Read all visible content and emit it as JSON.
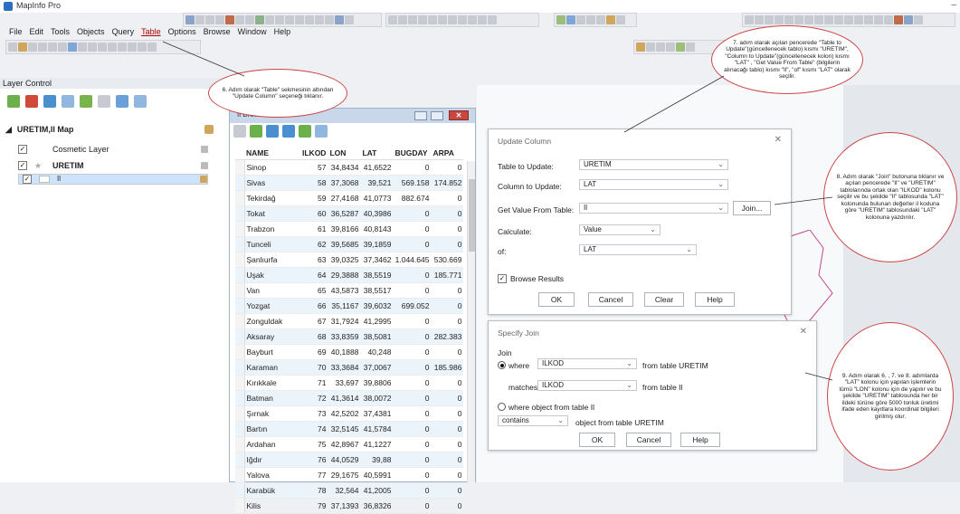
{
  "app": {
    "title": "MapInfo Pro"
  },
  "menu": [
    "File",
    "Edit",
    "Tools",
    "Objects",
    "Query",
    "Table",
    "Options",
    "Browse",
    "Window",
    "Help"
  ],
  "layer_control": {
    "title": "Layer Control",
    "map_name": "URETIM,Il Map",
    "layers": [
      {
        "name": "Cosmetic Layer",
        "checked": true
      },
      {
        "name": "URETIM",
        "checked": true
      },
      {
        "name": "Il",
        "checked": true
      }
    ]
  },
  "browser": {
    "title": "Il Browser",
    "columns": [
      "NAME",
      "ILKOD",
      "LON",
      "LAT",
      "BUGDAY",
      "ARPA"
    ],
    "rows": [
      [
        "Sinop",
        "57",
        "34,8434",
        "41,6522",
        "0",
        "0"
      ],
      [
        "Sivas",
        "58",
        "37,3068",
        "39,521",
        "569.158",
        "174.852"
      ],
      [
        "Tekirdağ",
        "59",
        "27,4168",
        "41,0773",
        "882.674",
        "0"
      ],
      [
        "Tokat",
        "60",
        "36,5287",
        "40,3986",
        "0",
        "0"
      ],
      [
        "Trabzon",
        "61",
        "39,8166",
        "40,8143",
        "0",
        "0"
      ],
      [
        "Tunceli",
        "62",
        "39,5685",
        "39,1859",
        "0",
        "0"
      ],
      [
        "Şanlıurfa",
        "63",
        "39,0325",
        "37,3462",
        "1.044.645",
        "530.669"
      ],
      [
        "Uşak",
        "64",
        "29,3888",
        "38,5519",
        "0",
        "185.771"
      ],
      [
        "Van",
        "65",
        "43,5873",
        "38,5517",
        "0",
        "0"
      ],
      [
        "Yozgat",
        "66",
        "35,1167",
        "39,6032",
        "699.052",
        "0"
      ],
      [
        "Zonguldak",
        "67",
        "31,7924",
        "41,2995",
        "0",
        "0"
      ],
      [
        "Aksaray",
        "68",
        "33,8359",
        "38,5081",
        "0",
        "282.383"
      ],
      [
        "Bayburt",
        "69",
        "40,1888",
        "40,248",
        "0",
        "0"
      ],
      [
        "Karaman",
        "70",
        "33,3684",
        "37,0067",
        "0",
        "185.986"
      ],
      [
        "Kırıkkale",
        "71",
        "33,697",
        "39,8806",
        "0",
        "0"
      ],
      [
        "Batman",
        "72",
        "41,3614",
        "38,0072",
        "0",
        "0"
      ],
      [
        "Şırnak",
        "73",
        "42,5202",
        "37,4381",
        "0",
        "0"
      ],
      [
        "Bartın",
        "74",
        "32,5145",
        "41,5784",
        "0",
        "0"
      ],
      [
        "Ardahan",
        "75",
        "42,8967",
        "41,1227",
        "0",
        "0"
      ],
      [
        "Iğdır",
        "76",
        "44,0529",
        "39,88",
        "0",
        "0"
      ],
      [
        "Yalova",
        "77",
        "29,1675",
        "40,5991",
        "0",
        "0"
      ],
      [
        "Karabük",
        "78",
        "32,564",
        "41,2005",
        "0",
        "0"
      ],
      [
        "Kilis",
        "79",
        "37,1393",
        "36,8326",
        "0",
        "0"
      ]
    ]
  },
  "update_column": {
    "title": "Update Column",
    "table_to_update_label": "Table to Update:",
    "table_to_update": "URETIM",
    "column_to_update_label": "Column to Update:",
    "column_to_update": "LAT",
    "get_value_label": "Get Value From Table:",
    "get_value": "Il",
    "join_button": "Join...",
    "calculate_label": "Calculate:",
    "calculate": "Value",
    "of_label": "of:",
    "of": "LAT",
    "browse_results": "Browse Results",
    "ok": "OK",
    "cancel": "Cancel",
    "clear": "Clear",
    "help": "Help"
  },
  "specify_join": {
    "title": "Specify Join",
    "join_label": "Join",
    "where_label": "where",
    "where_value": "ILKOD",
    "from_table_uretim": "from table URETIM",
    "matches_label": "matches",
    "matches_value": "ILKOD",
    "from_table_il": "from table Il",
    "where_object_label": "where object from table Il",
    "contains": "contains",
    "object_from": "object from table URETIM",
    "ok": "OK",
    "cancel": "Cancel",
    "help": "Help"
  },
  "callouts": {
    "step6": "6. Adım olarak \"Table\" sekmesinin altından \"Update Column\" seçeneği tıklanır.",
    "step7": "7. adım olarak açılan pencerede \"Table to Update\"(güncellenecek tablo) kısmı \"URETIM\", \"Column to Update\"(güncellenecek kolon) kısmı \"LAT\" , \"Get Value From Table\" (bilgilerin alınacağı tablo) kısmı \"Il\", \"of\" kısmı \"LAT\" olarak seçilir.",
    "step8": "8. Adım olarak \"Join\" butonuna tıklanır ve açılan pencerede \"Il\" ve \"URETIM\" tablolarında ortak olan \"ILKOD\" kolonu seçilir ve bu şekilde \"Il\" tablosunda \"LAT\" kolonunda bulunan değerler il koduna göre \"URETIM\" tablosundaki \"LAT\" kolonuna yazdırılır.",
    "step9": "9. Adım olarak 6. , 7. ve 8. adımlarda \"LAT\" kolonu için yapılan işlemlerin tümü \"LON\" kolonu için de yapılır ve bu şekilde \"URETIM\" tablosunda her bir ildeki türüne göre 5000 tonluk üretimi ifade eden kayıtlara koordinat bilgileri girilmiş olur."
  },
  "colors": {
    "accent_red": "#c9473f",
    "selection": "#cde4fb",
    "titlebar_blue": "#c9d7ea"
  }
}
